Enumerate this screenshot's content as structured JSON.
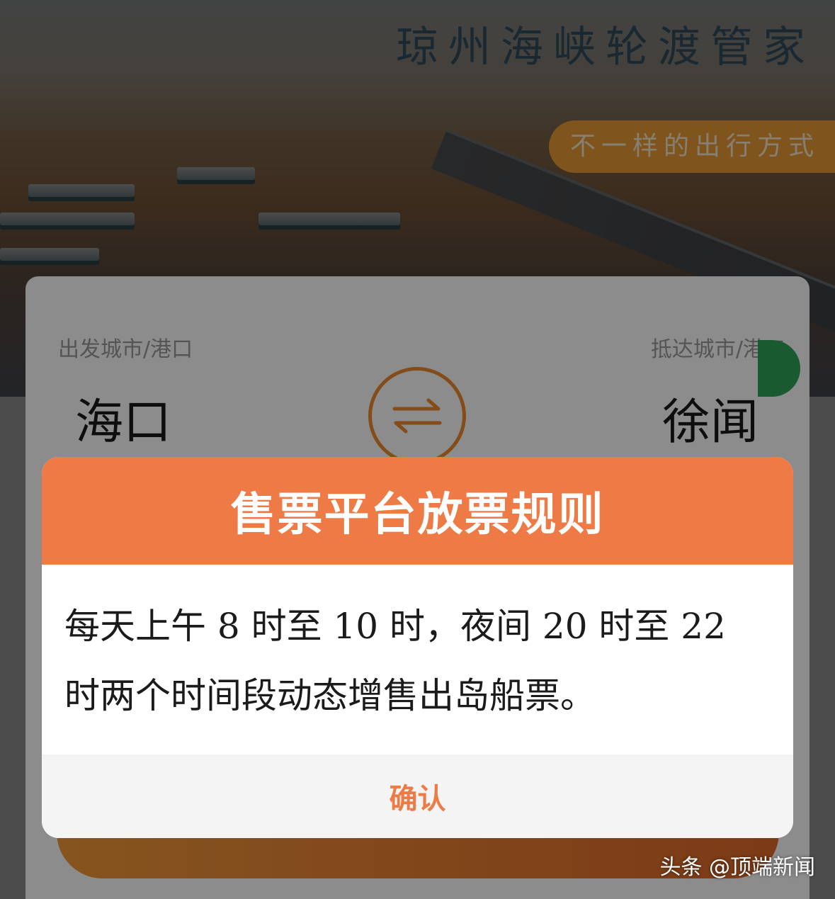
{
  "app": {
    "title": "琼州海峡轮渡管家",
    "slogan": "不一样的出行方式"
  },
  "search": {
    "from_label": "出发城市/港口",
    "to_label": "抵达城市/港口",
    "from_city": "海口",
    "to_city": "徐闻",
    "swap_icon": "swap-arrows-icon",
    "accent_color": "#f08a2f"
  },
  "modal": {
    "title": "售票平台放票规则",
    "body": "每天上午 8 时至 10 时，夜间 20 时至 22 时两个时间段动态增售出岛船票。",
    "confirm_label": "确认",
    "header_color": "#ee7a45"
  },
  "watermark": {
    "text": "头条 @顶端新闻"
  }
}
